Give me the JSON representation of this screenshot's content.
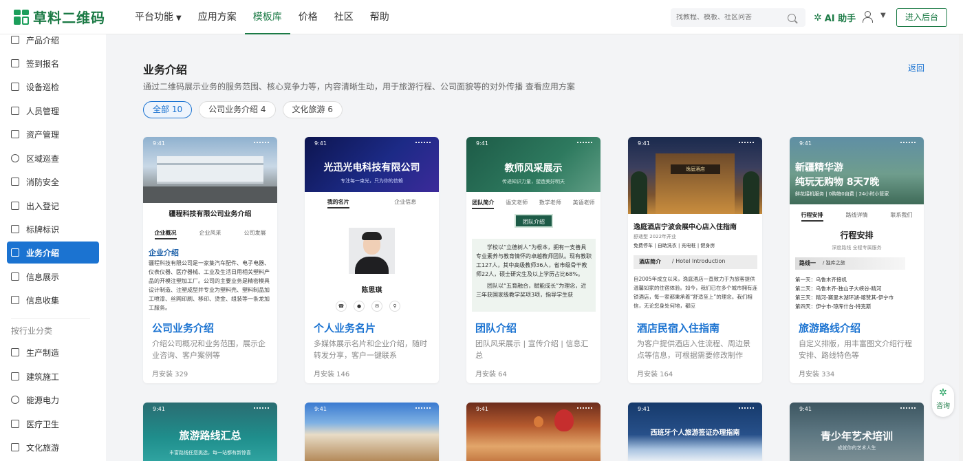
{
  "brand": {
    "name": "草料二维码"
  },
  "nav": {
    "items": [
      {
        "label": "平台功能",
        "caret": "⌄",
        "active": false
      },
      {
        "label": "应用方案",
        "active": false
      },
      {
        "label": "模板库",
        "active": true
      },
      {
        "label": "价格",
        "active": false
      },
      {
        "label": "社区",
        "active": false
      },
      {
        "label": "帮助",
        "active": false
      }
    ]
  },
  "search": {
    "placeholder": "找教程、模板、社区问答"
  },
  "ai": {
    "label": "AI 助手"
  },
  "enter_btn": "进入后台",
  "sidebar": {
    "items": [
      "产品介绍",
      "签到报名",
      "设备巡检",
      "人员管理",
      "资产管理",
      "区域巡查",
      "消防安全",
      "出入登记",
      "标牌标识",
      "业务介绍",
      "信息展示",
      "信息收集"
    ],
    "active_index": 9,
    "group_label": "按行业分类",
    "industry_items": [
      "生产制造",
      "建筑施工",
      "能源电力",
      "医疗卫生",
      "文化旅游"
    ]
  },
  "page": {
    "title": "业务介绍",
    "back": "返回",
    "desc": "通过二维码展示业务的服务范围、核心竞争力等，内容清晰生动，用于旅游行程、公司面貌等的对外传播",
    "desc_link": "查看应用方案"
  },
  "filters": [
    "全部 10",
    "公司业务介绍 4",
    "文化旅游 6"
  ],
  "cards": [
    {
      "title": "公司业务介绍",
      "desc": "介绍公司概况和业务范围，展示企业咨询、客户案例等",
      "stat": "月安装 329",
      "thumb": {
        "status": "9:41",
        "heading": "疆程科技有限公司业务介绍",
        "tabs": [
          "企业概况",
          "企业风采",
          "公司发展"
        ],
        "section": "企业介绍",
        "body": "疆程科技有限公司是一家集汽车配件、电子电器、仪表仪器、医疗器械、工业及生活日用相关塑料产品的开模注塑加工厂。公司的主要业务是精密模具设计制造、注塑成型并专业为塑料壳、塑料制品加工喷漆、丝网印刷、移印、烫金、组装等一条龙加工服务。"
      }
    },
    {
      "title": "个人业务名片",
      "desc": "多媒体展示名片和企业介绍，随时转发分享，客户一键联系",
      "stat": "月安装 146",
      "thumb": {
        "status": "9:41",
        "heading": "光迅光电科技有限公司",
        "sub": "专注每一束光，只为你的信赖",
        "tabs": [
          "我的名片",
          "企业信息"
        ],
        "name": "陈思琪"
      }
    },
    {
      "title": "团队介绍",
      "desc": "团队风采展示 | 宣传介绍 | 信息汇总",
      "stat": "月安装 64",
      "thumb": {
        "status": "9:41",
        "heading": "教师风采展示",
        "sub": "传递知识力量，塑造美好明天",
        "tabs": [
          "团队简介",
          "语文老师",
          "数学老师",
          "英语老师"
        ],
        "badge": "团队介绍",
        "body1": "学校以“立德树人”为根本，拥有一支善具专业素养与教育情怀的卓越教师团队。现有教职工127人，其中高级教师36人，省市级骨干教师22人，硕士研究生及以上学历占比68%。",
        "body2": "团队以“五育融合，赋能成长”为理念，近三年获国家级教学奖项3项，指导学生获"
      }
    },
    {
      "title": "酒店民宿入住指南",
      "desc": "为客户提供酒店入住流程、周边景点等信息，可根据需要修改制作",
      "stat": "月安装 164",
      "thumb": {
        "status": "9:41",
        "sign": "逸庭酒店",
        "heading": "逸庭酒店宁波会展中心店入住指南",
        "meta": "舒适型  2022年开业",
        "tags": "免费停车 | 自助洗衣 | 充电桩 | 健身房",
        "section": "酒店简介",
        "section_en": "/ Hotel Introduction",
        "body": "自2005年成立以来，逸庭酒店一直致力于为旅客提供温馨如家的住宿体验。如今，我们已在多个城市拥有连锁酒店，每一家都秉承着“舒适至上”的理念。我们相信，无论您身处何地，都应"
      }
    },
    {
      "title": "旅游路线介绍",
      "desc": "自定义排版，用丰富图文介绍行程安排、路线特色等",
      "stat": "月安装 334",
      "thumb": {
        "status": "9:41",
        "heading1": "新疆精华游",
        "heading2": "纯玩无购物 8天7晚",
        "tags": "鲜花接机服务 | 0购物0自费 | 24小时小管家",
        "tabs": [
          "行程安排",
          "路线详情",
          "联系我们"
        ],
        "section": "行程安排",
        "sub": "深度路线 全程专属服务",
        "route": "路线一",
        "route_sub": "/ 独库之旅",
        "days": [
          "第一天：乌鲁木齐接机",
          "第二天：乌鲁木齐-独山子大峡谷-精河",
          "第三天：精河-赛里木湖环湖-喀赞其-伊宁市",
          "第四天：伊宁市-琼库什台-特克斯"
        ]
      }
    },
    {
      "thumb": {
        "status": "9:41",
        "heading": "旅游路线汇总",
        "sub": "丰富路线任您挑选，每一站都有新惊喜"
      }
    },
    {
      "thumb": {
        "status": "9:41"
      }
    },
    {
      "thumb": {
        "status": "9:41"
      }
    },
    {
      "thumb": {
        "status": "9:41",
        "heading": "西班牙个人旅游签证办理指南"
      }
    },
    {
      "thumb": {
        "status": "9:41",
        "heading": "青少年艺术培训",
        "sub": "成就你的艺术人生"
      }
    }
  ],
  "consult": {
    "label": "咨询"
  }
}
